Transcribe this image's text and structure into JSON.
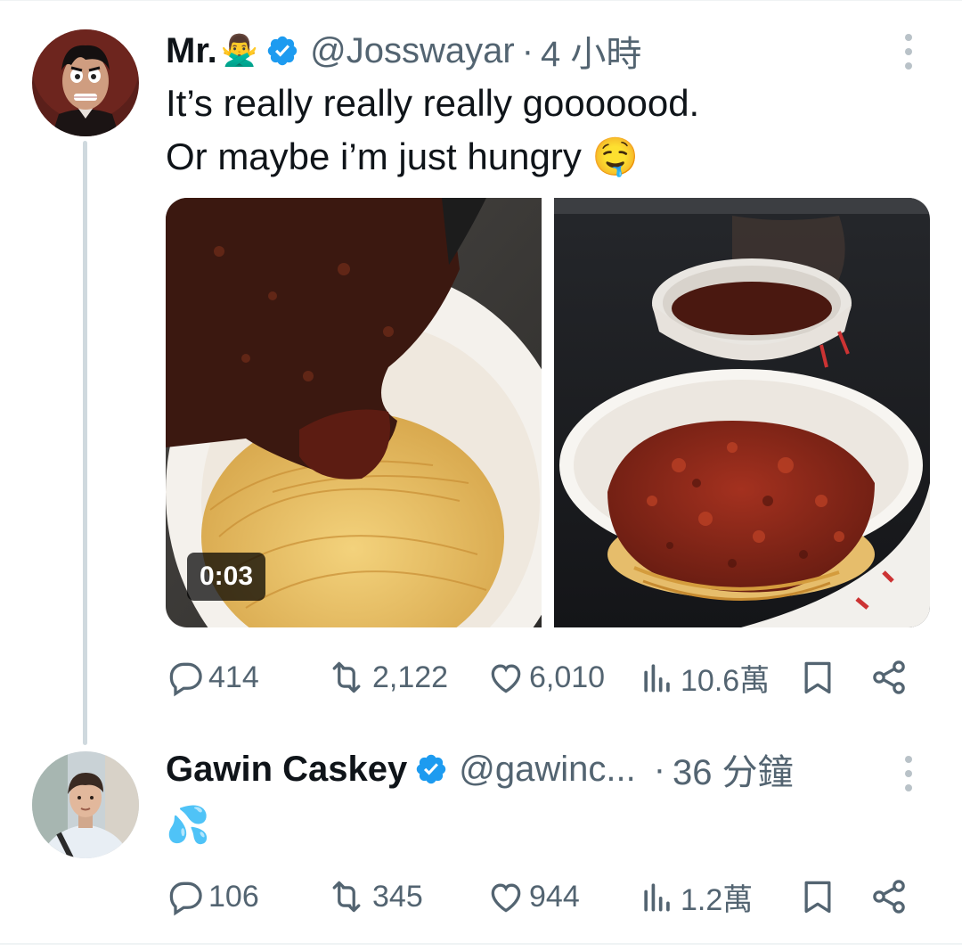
{
  "tweets": [
    {
      "name": "Mr.",
      "name_emoji": "🙅‍♂️",
      "handle": "@Josswayar",
      "separator": "·",
      "time": "4 小時",
      "text_lines": [
        "It’s really really really gooooood.",
        "Or maybe i’m just hungry 🤤"
      ],
      "media": {
        "video_duration": "0:03"
      },
      "stats": {
        "replies": "414",
        "reposts": "2,122",
        "likes": "6,010",
        "views": "10.6萬"
      }
    },
    {
      "name": "Gawin Caskey",
      "handle": "@gawinc...",
      "separator": "·",
      "time": "36 分鐘",
      "text": "💦",
      "stats": {
        "replies": "106",
        "reposts": "345",
        "likes": "944",
        "views": "1.2萬"
      }
    }
  ],
  "icons": {
    "verified": "verified-badge-icon",
    "more": "more-vertical-icon",
    "reply": "reply-icon",
    "repost": "repost-icon",
    "like": "heart-icon",
    "views": "views-icon",
    "bookmark": "bookmark-icon",
    "share": "share-icon"
  },
  "colors": {
    "verified": "#1d9bf0",
    "secondary_text": "#536471",
    "thread_line": "#cfd9de"
  }
}
